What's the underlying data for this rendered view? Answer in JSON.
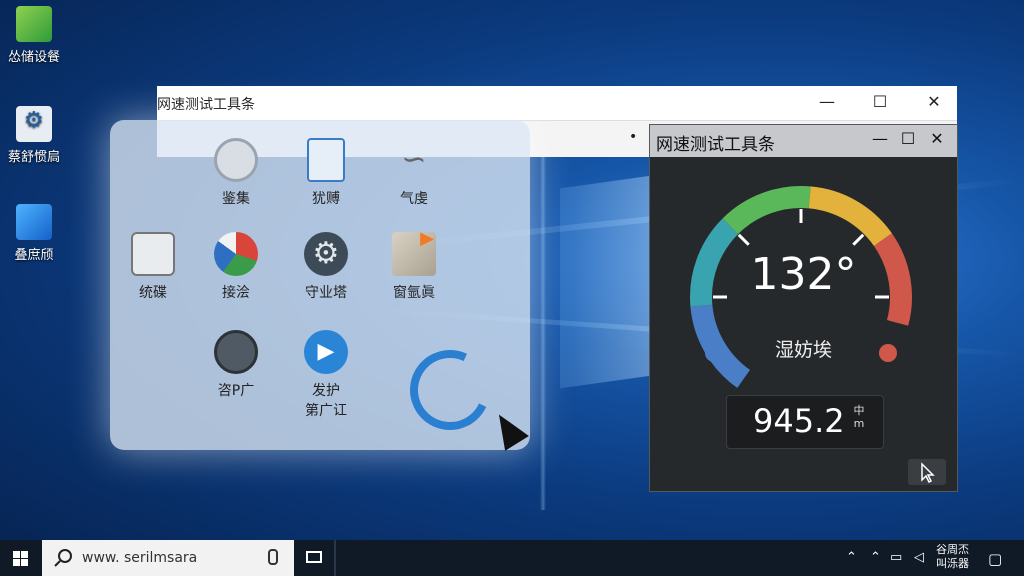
{
  "desktop": {
    "icons": [
      {
        "label": "怂储设餐",
        "icon": "green-folder-icon"
      },
      {
        "label": "蔡舒惯扃",
        "icon": "gear-document-icon"
      },
      {
        "label": "叠庶颀",
        "icon": "blue-app-icon"
      }
    ]
  },
  "main_window": {
    "title": "网速测试工具条",
    "minimize": "—",
    "maximize": "☐",
    "close": "✕",
    "toolbar_glyph": "•"
  },
  "launcher": {
    "apps": [
      {
        "label": "鉴集",
        "icon": "power-icon"
      },
      {
        "label": "犹赙",
        "icon": "clipboard-icon"
      },
      {
        "label": "气虔",
        "icon": "signature-icon"
      },
      {
        "label": "统碟",
        "icon": "toolbox-icon"
      },
      {
        "label": "接浍",
        "icon": "pie-chart-icon"
      },
      {
        "label": "守业塔",
        "icon": "settings-gear-icon"
      },
      {
        "label": "窗氩眞",
        "icon": "map-pin-icon"
      },
      {
        "label": "咨P广",
        "icon": "clock-icon"
      },
      {
        "label": "发护\n第广讧",
        "icon": "play-icon"
      }
    ]
  },
  "gauge_window": {
    "title": "网速测试工具条",
    "minimize": "—",
    "maximize": "☐",
    "close": "✕",
    "gauge_value": "132°",
    "gauge_label": "湿妨埃",
    "readout_value": "945.2",
    "readout_unit_top": "中",
    "readout_unit_bottom": "m",
    "colors": [
      "#4a7fc8",
      "#3aa3b0",
      "#5bb85a",
      "#e3b23c",
      "#d0584a"
    ]
  },
  "taskbar": {
    "search_text": "www. serilmsara",
    "tray_text_top": "谷周㶨",
    "tray_text_bottom": "叫泺器"
  }
}
